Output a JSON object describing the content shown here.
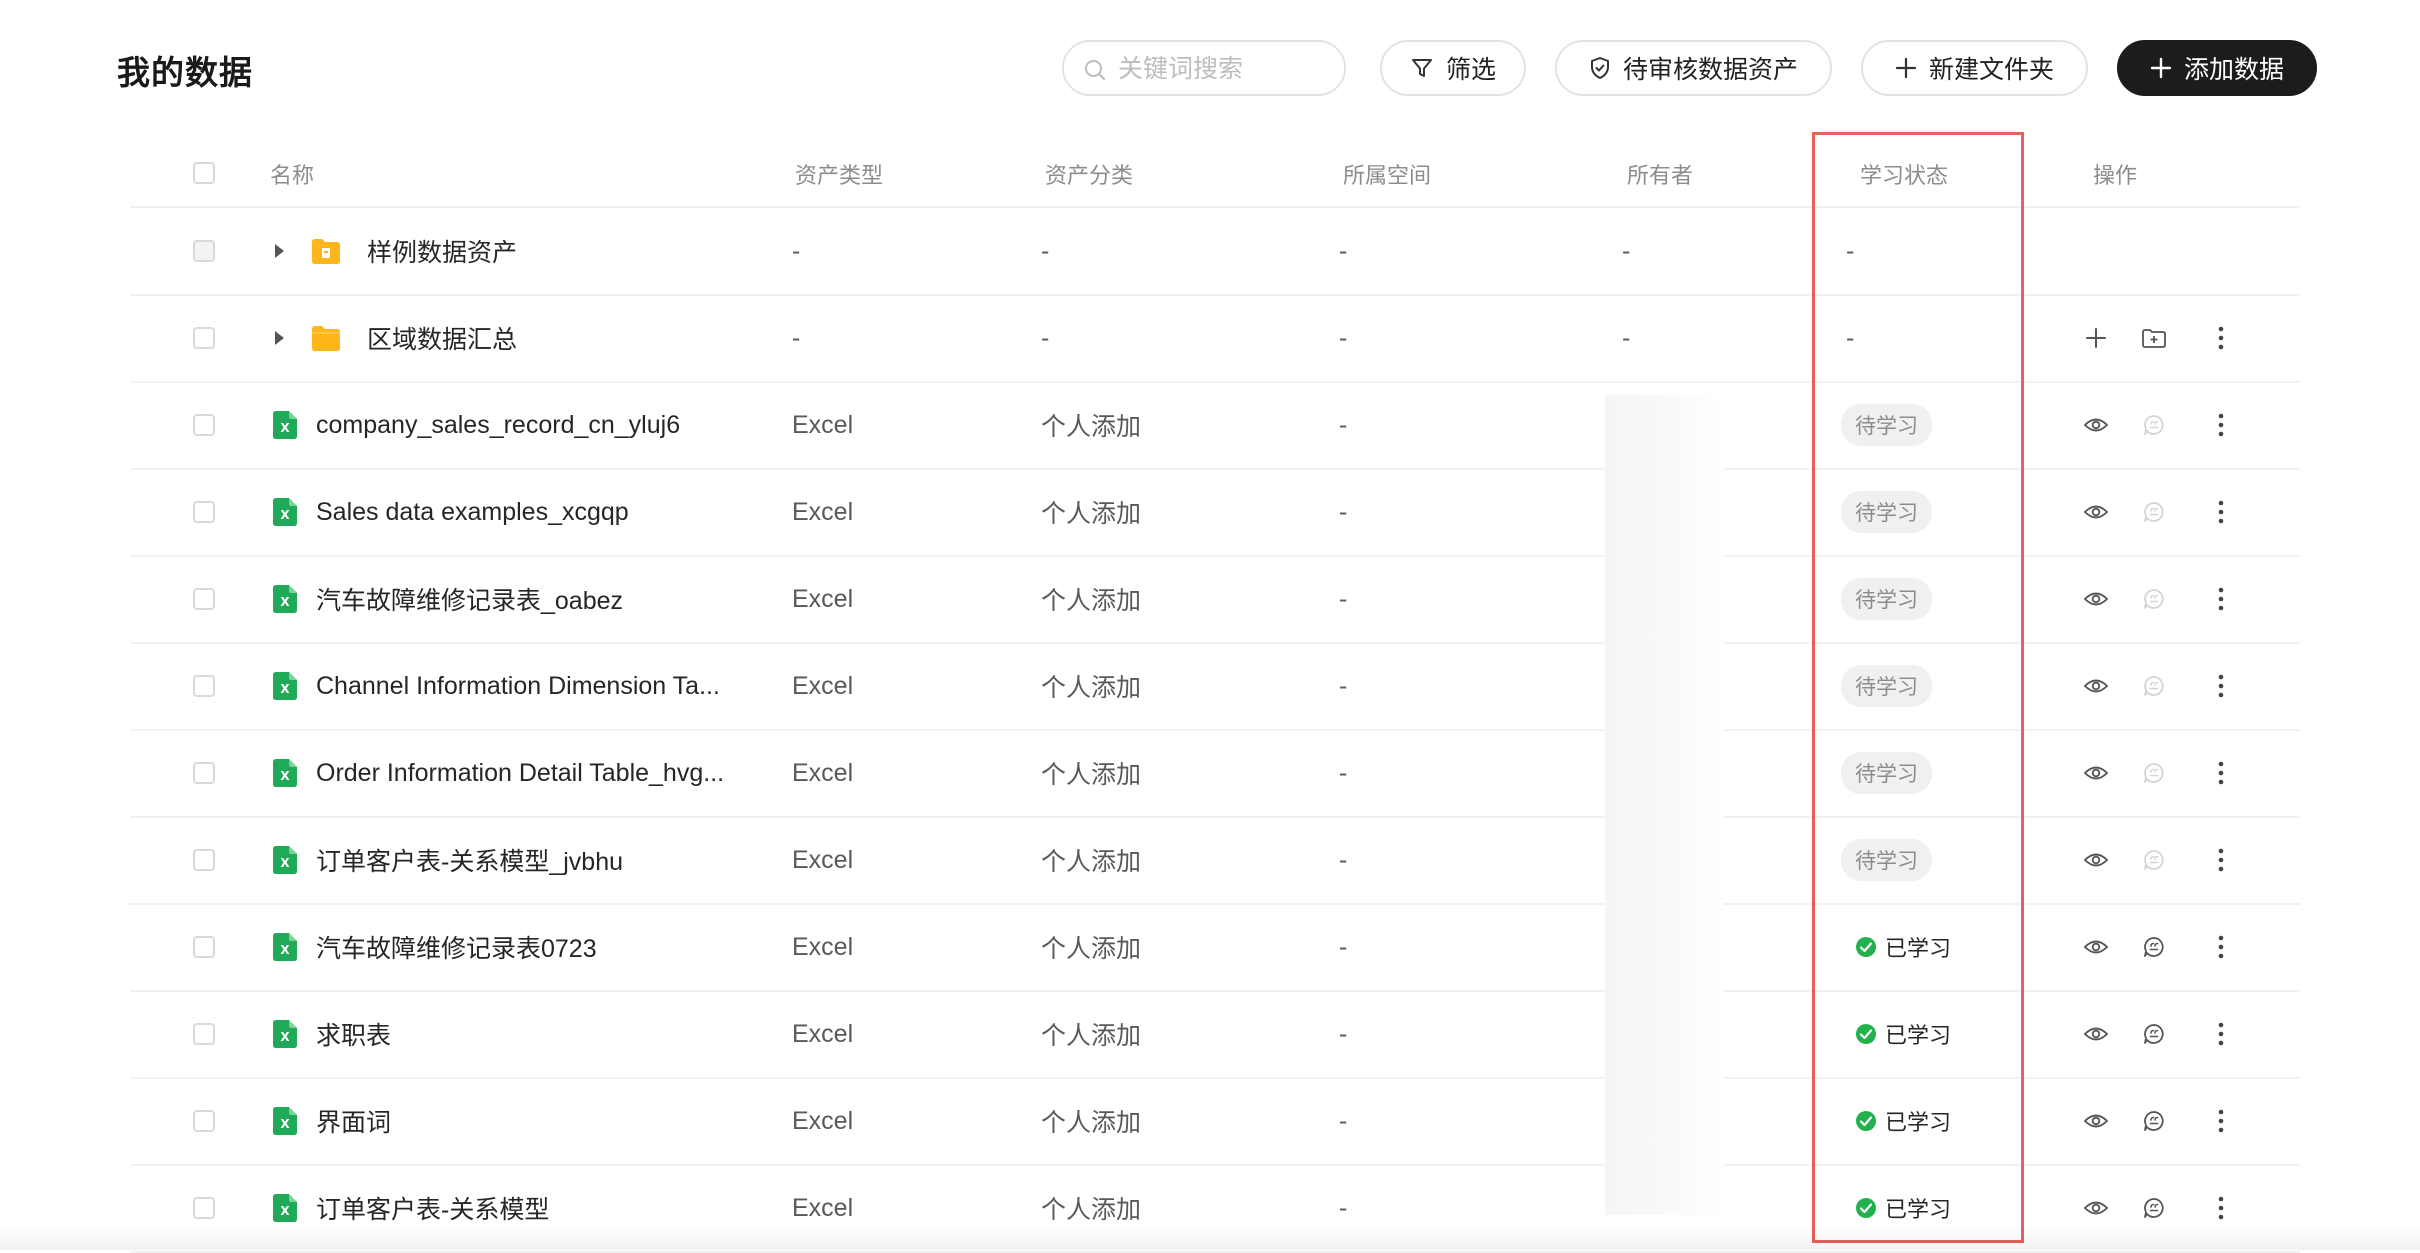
{
  "page": {
    "title": "我的数据"
  },
  "toolbar": {
    "search_placeholder": "关键词搜索",
    "filter_label": "筛选",
    "review_label": "待审核数据资产",
    "new_folder_label": "新建文件夹",
    "add_data_label": "添加数据"
  },
  "columns": {
    "name": "名称",
    "asset_type": "资产类型",
    "asset_category": "资产分类",
    "space": "所属空间",
    "owner": "所有者",
    "learning_status": "学习状态",
    "actions": "操作"
  },
  "rows": [
    {
      "kind": "folder",
      "icon": "folder-sample-icon",
      "name": "样例数据资产",
      "asset_type": "-",
      "asset_category": "-",
      "space": "-",
      "owner": "-",
      "status": "-",
      "status_kind": "none",
      "checkbox_disabled": true,
      "actions": []
    },
    {
      "kind": "folder",
      "icon": "folder-icon",
      "name": "区域数据汇总",
      "asset_type": "-",
      "asset_category": "-",
      "space": "-",
      "owner": "-",
      "status": "-",
      "status_kind": "none",
      "checkbox_disabled": false,
      "actions": [
        "add",
        "add-folder",
        "more"
      ]
    },
    {
      "kind": "file",
      "icon": "excel-icon",
      "name": "company_sales_record_cn_yluj6",
      "asset_type": "Excel",
      "asset_category": "个人添加",
      "space": "-",
      "owner": "",
      "status": "待学习",
      "status_kind": "pending",
      "actions": [
        "view",
        "chat-disabled",
        "more"
      ]
    },
    {
      "kind": "file",
      "icon": "excel-icon",
      "name": "Sales data examples_xcgqp",
      "asset_type": "Excel",
      "asset_category": "个人添加",
      "space": "-",
      "owner": "",
      "status": "待学习",
      "status_kind": "pending",
      "actions": [
        "view",
        "chat-disabled",
        "more"
      ]
    },
    {
      "kind": "file",
      "icon": "excel-icon",
      "name": "汽车故障维修记录表_oabez",
      "asset_type": "Excel",
      "asset_category": "个人添加",
      "space": "-",
      "owner": "",
      "status": "待学习",
      "status_kind": "pending",
      "actions": [
        "view",
        "chat-disabled",
        "more"
      ]
    },
    {
      "kind": "file",
      "icon": "excel-icon",
      "name": "Channel Information Dimension Ta...",
      "asset_type": "Excel",
      "asset_category": "个人添加",
      "space": "-",
      "owner": "",
      "status": "待学习",
      "status_kind": "pending",
      "actions": [
        "view",
        "chat-disabled",
        "more"
      ]
    },
    {
      "kind": "file",
      "icon": "excel-icon",
      "name": "Order Information Detail Table_hvg...",
      "asset_type": "Excel",
      "asset_category": "个人添加",
      "space": "-",
      "owner": "",
      "status": "待学习",
      "status_kind": "pending",
      "actions": [
        "view",
        "chat-disabled",
        "more"
      ]
    },
    {
      "kind": "file",
      "icon": "excel-icon",
      "name": "订单客户表-关系模型_jvbhu",
      "asset_type": "Excel",
      "asset_category": "个人添加",
      "space": "-",
      "owner": "",
      "status": "待学习",
      "status_kind": "pending",
      "actions": [
        "view",
        "chat-disabled",
        "more"
      ]
    },
    {
      "kind": "file",
      "icon": "excel-icon",
      "name": "汽车故障维修记录表0723",
      "asset_type": "Excel",
      "asset_category": "个人添加",
      "space": "-",
      "owner": "",
      "status": "已学习",
      "status_kind": "learned",
      "actions": [
        "view",
        "chat",
        "more"
      ]
    },
    {
      "kind": "file",
      "icon": "excel-icon",
      "name": "求职表",
      "asset_type": "Excel",
      "asset_category": "个人添加",
      "space": "-",
      "owner": "",
      "status": "已学习",
      "status_kind": "learned",
      "actions": [
        "view",
        "chat",
        "more"
      ]
    },
    {
      "kind": "file",
      "icon": "excel-icon",
      "name": "界面词",
      "asset_type": "Excel",
      "asset_category": "个人添加",
      "space": "-",
      "owner": "",
      "status": "已学习",
      "status_kind": "learned",
      "actions": [
        "view",
        "chat",
        "more"
      ]
    },
    {
      "kind": "file",
      "icon": "excel-icon",
      "name": "订单客户表-关系模型",
      "asset_type": "Excel",
      "asset_category": "个人添加",
      "space": "-",
      "owner": "",
      "status": "已学习",
      "status_kind": "learned",
      "actions": [
        "view",
        "chat",
        "more"
      ]
    }
  ],
  "colors": {
    "accent_dark": "#1c1c1c",
    "excel_green": "#21a95a",
    "folder_yellow": "#ffb61c",
    "learned_green": "#22b14c",
    "highlight_red": "#e8605a",
    "pending_bg": "#f0f0f0"
  }
}
